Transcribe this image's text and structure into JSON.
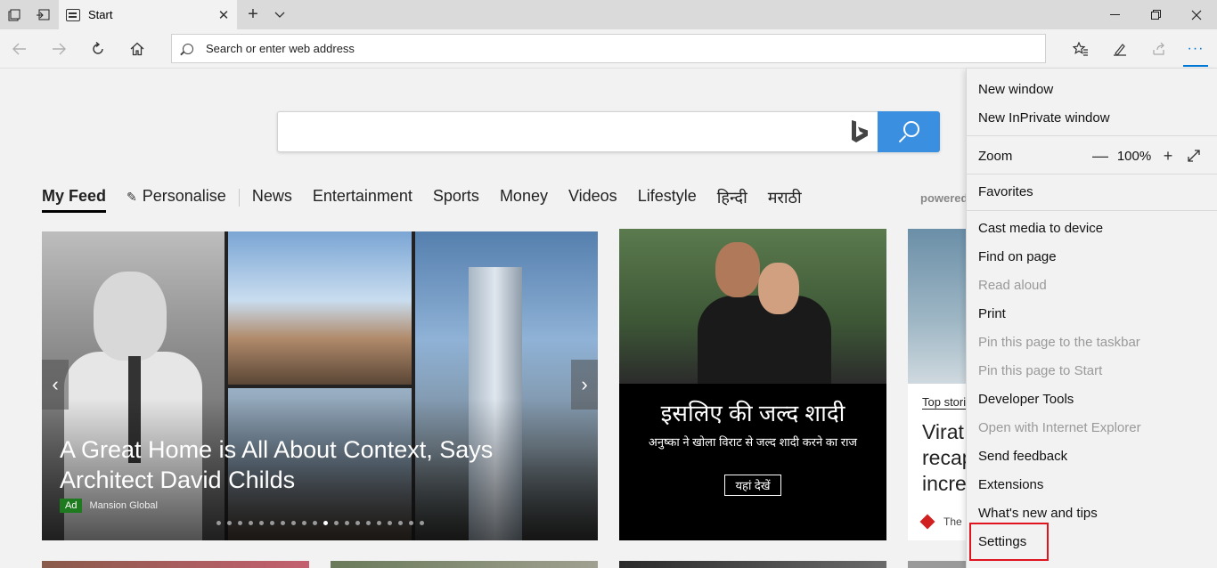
{
  "browser": {
    "tab": {
      "title": "Start"
    },
    "icons": {
      "tab_actions": "tabs-aside-icon",
      "tab_restore": "set-aside-icon",
      "new_tab": "plus-icon",
      "tab_list": "chevron-down-icon",
      "minimize": "minimize-icon",
      "restore": "restore-icon",
      "close": "close-icon"
    },
    "address_bar": {
      "placeholder": "Search or enter web address"
    },
    "toolbar_icons": [
      "star-list-icon",
      "pen-icon",
      "share-icon",
      "more-icon"
    ]
  },
  "page": {
    "feed_tabs": [
      {
        "label": "My Feed",
        "active": true
      },
      {
        "label": "Personalise"
      },
      {
        "label": "News"
      },
      {
        "label": "Entertainment"
      },
      {
        "label": "Sports"
      },
      {
        "label": "Money"
      },
      {
        "label": "Videos"
      },
      {
        "label": "Lifestyle"
      },
      {
        "label": "हिन्दी"
      },
      {
        "label": "मराठी"
      }
    ],
    "powered_by": "powered",
    "hero": {
      "headline": "A Great Home is All About Context, Says Architect David Childs",
      "ad_label": "Ad",
      "source": "Mansion Global",
      "slide_count": 20,
      "active_slide": 10
    },
    "promo": {
      "title": "इसलिए की जल्द शादी",
      "subtitle": "अनुष्का ने खोला विराट से जल्द शादी करने का राज",
      "cta": "यहां देखें"
    },
    "side_story": {
      "label": "Top stori",
      "headline_lines": [
        "Virat",
        "recap",
        "incre"
      ],
      "source": "The"
    }
  },
  "menu": {
    "items": [
      {
        "label": "New window",
        "disabled": false
      },
      {
        "label": "New InPrivate window",
        "disabled": false
      },
      {
        "label": "Zoom",
        "disabled": false
      },
      {
        "label": "Favorites",
        "disabled": false
      },
      {
        "label": "Cast media to device",
        "disabled": false
      },
      {
        "label": "Find on page",
        "disabled": false
      },
      {
        "label": "Read aloud",
        "disabled": true
      },
      {
        "label": "Print",
        "disabled": false
      },
      {
        "label": "Pin this page to the taskbar",
        "disabled": true
      },
      {
        "label": "Pin this page to Start",
        "disabled": true
      },
      {
        "label": "Developer Tools",
        "disabled": false
      },
      {
        "label": "Open with Internet Explorer",
        "disabled": true
      },
      {
        "label": "Send feedback",
        "disabled": false
      },
      {
        "label": "Extensions",
        "disabled": false
      },
      {
        "label": "What's new and tips",
        "disabled": false
      },
      {
        "label": "Settings",
        "disabled": false,
        "highlighted": true
      }
    ],
    "zoom_value": "100%",
    "zoom_minus": "—",
    "zoom_plus": "+"
  },
  "colors": {
    "accent": "#0078d7",
    "highlight_box": "#e0141e",
    "bing_button": "#3b8fe0"
  }
}
